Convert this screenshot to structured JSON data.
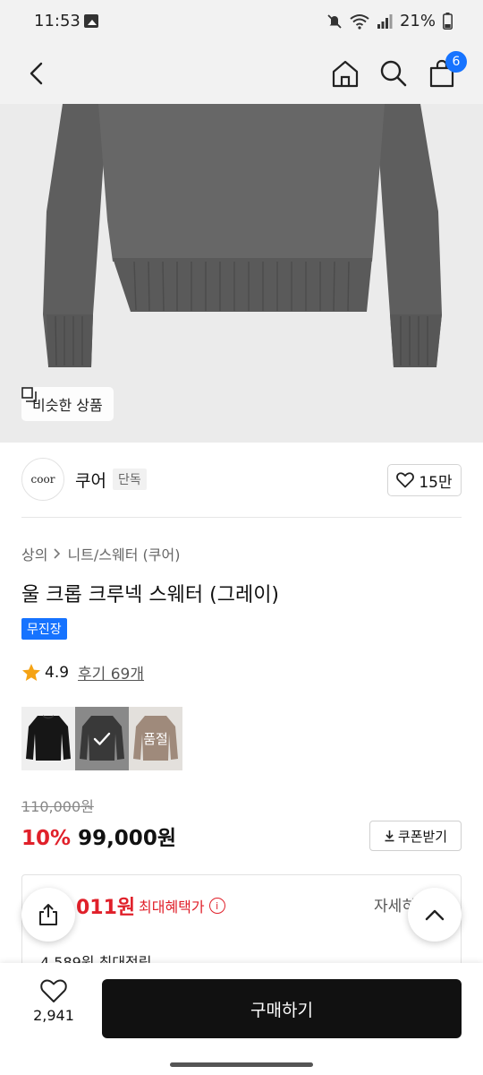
{
  "status_bar": {
    "time": "11:53",
    "battery": "21%",
    "icons": [
      "image-icon",
      "mute-icon",
      "wifi-icon",
      "signal-icon",
      "battery-icon"
    ]
  },
  "nav": {
    "icons": [
      "back-arrow-icon",
      "home-icon",
      "search-icon",
      "shopping-bag-icon"
    ],
    "cart_count": "6"
  },
  "product_image": {
    "similar_label": "비슷한 상품"
  },
  "brand": {
    "logo_text": "coor",
    "name": "쿠어",
    "badge": "단독",
    "like_count": "15만"
  },
  "product": {
    "breadcrumb": [
      "상의",
      "니트/스웨터 (쿠어)"
    ],
    "title": "울 크롭 크루넥 스웨터 (그레이)",
    "tag": "무진장",
    "rating": "4.9",
    "review_link": "후기 69개",
    "color_options": [
      {
        "color": "black",
        "selected": false,
        "sold_out": false
      },
      {
        "color": "gray",
        "selected": true,
        "sold_out": false
      },
      {
        "color": "brown",
        "selected": false,
        "sold_out": true,
        "sold_out_label": "품절"
      }
    ],
    "original_price": "110,000원",
    "discount": "10%",
    "sale_price": "99,000원",
    "coupon_label": "쿠폰받기"
  },
  "benefit": {
    "price_partial": "011원",
    "label": "최대혜택가",
    "detail_partial": "자세히",
    "points_partial": "4,589원 최대적립"
  },
  "bottom_bar": {
    "wish_count": "2,941",
    "buy_label": "구매하기"
  },
  "colors": {
    "accent_blue": "#1673ff",
    "sale_red": "#e0202a",
    "buy_button": "#111111"
  }
}
